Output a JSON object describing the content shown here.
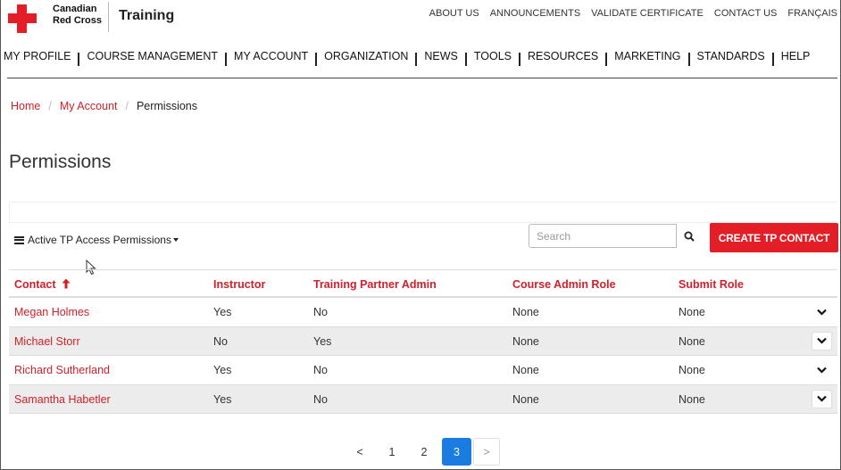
{
  "brand": {
    "line1": "Canadian",
    "line2": "Red Cross",
    "site_title": "Training"
  },
  "utility_nav": [
    "ABOUT US",
    "ANNOUNCEMENTS",
    "VALIDATE CERTIFICATE",
    "CONTACT US",
    "FRANÇAIS"
  ],
  "main_nav": [
    "MY PROFILE",
    "COURSE MANAGEMENT",
    "MY ACCOUNT",
    "ORGANIZATION",
    "NEWS",
    "TOOLS",
    "RESOURCES",
    "MARKETING",
    "STANDARDS",
    "HELP"
  ],
  "breadcrumb": {
    "home": "Home",
    "account": "My Account",
    "current": "Permissions"
  },
  "page_title": "Permissions",
  "toolbar": {
    "filter_label": "Active TP Access Permissions",
    "search_placeholder": "Search",
    "create_label": "CREATE TP CONTACT"
  },
  "table": {
    "headers": [
      "Contact",
      "Instructor",
      "Training Partner Admin",
      "Course Admin Role",
      "Submit Role"
    ],
    "rows": [
      [
        "Megan Holmes",
        "Yes",
        "No",
        "None",
        "None"
      ],
      [
        "Michael Storr",
        "No",
        "Yes",
        "None",
        "None"
      ],
      [
        "Richard Sutherland",
        "Yes",
        "No",
        "None",
        "None"
      ],
      [
        "Samantha Habetler",
        "Yes",
        "No",
        "None",
        "None"
      ]
    ]
  },
  "pagination": {
    "prev": "<",
    "pages": [
      "1",
      "2",
      "3"
    ],
    "current": "3",
    "next": ">"
  },
  "colors": {
    "accent": "#e41e26",
    "link": "#d0202a",
    "active_page": "#1a7be0"
  }
}
